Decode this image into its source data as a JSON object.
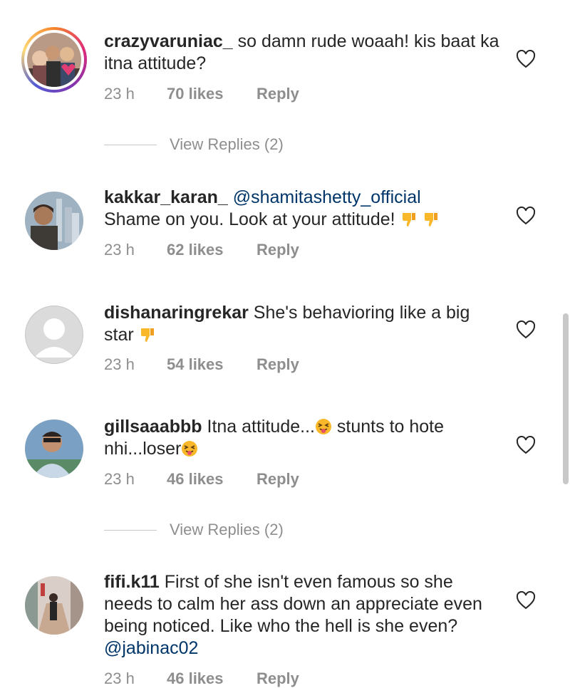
{
  "comments": [
    {
      "username": "crazyvaruniac_",
      "text": " so damn rude woaah! kis baat ka itna attitude?",
      "time": "23 h",
      "likes": "70 likes",
      "reply": "Reply",
      "view_replies": "View Replies (2)"
    },
    {
      "username": "kakkar_karan_",
      "mention": "@shamitashetty_official",
      "text": "Shame on you. Look at your attitude!",
      "time": "23 h",
      "likes": "62 likes",
      "reply": "Reply"
    },
    {
      "username": "dishanaringrekar",
      "text": " She's behavioring like a big star",
      "time": "23 h",
      "likes": "54 likes",
      "reply": "Reply"
    },
    {
      "username": "gillsaaabbb",
      "text_a": " Itna attitude...",
      "text_b": " stunts to hote nhi...loser",
      "time": "23 h",
      "likes": "46 likes",
      "reply": "Reply",
      "view_replies": "View Replies (2)"
    },
    {
      "username": "fifi.k11",
      "text": " First of she isn't even famous so she needs to calm her ass down an appreciate even being noticed. Like who the hell is she even? ",
      "mention": "@jabinac02",
      "time": "23 h",
      "likes": "46 likes",
      "reply": "Reply"
    }
  ],
  "icons": {
    "heart": "heart-outline-icon",
    "thumbs_down": "thumbs-down-emoji",
    "squint_tongue": "squinting-tongue-emoji"
  },
  "colors": {
    "mention": "#003569",
    "meta": "#8e8e8e",
    "emoji": "#f9b82a"
  }
}
